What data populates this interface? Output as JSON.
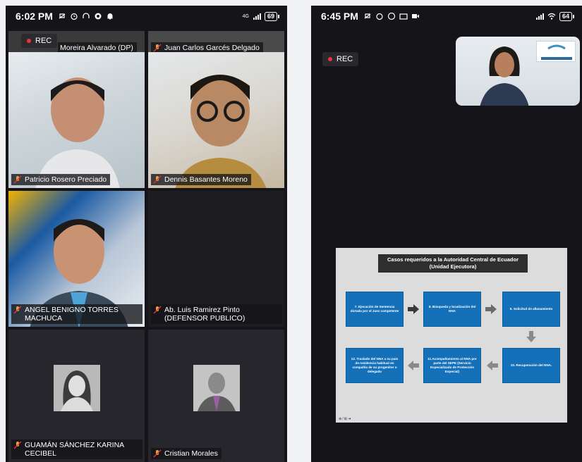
{
  "left_phone": {
    "status": {
      "time": "6:02 PM",
      "network": "4G",
      "battery": "69"
    },
    "rec_label": "REC",
    "participants": [
      {
        "name": "Moreira Alvarado (DP)"
      },
      {
        "name": "Juan Carlos Garcés Delgado"
      },
      {
        "name": "Patricio Rosero Preciado"
      },
      {
        "name": "Dennis Basantes Moreno"
      },
      {
        "name": "ANGEL BENIGNO TORRES MACHUCA"
      },
      {
        "name": "Ab. Luis Ramirez Pinto (DEFENSOR PUBLICO)"
      },
      {
        "name": "GUAMÁN SÁNCHEZ KARINA CECIBEL"
      },
      {
        "name": "Cristian Morales"
      }
    ]
  },
  "right_phone": {
    "status": {
      "time": "6:45 PM",
      "battery": "64"
    },
    "rec_label": "REC",
    "slide": {
      "title_line1": "Casos requeridos a la Autoridad Central de Ecuador",
      "title_line2": "(Unidad Ejecutora)",
      "steps": [
        "7. Ejecución de Sentencia dictada por el Juez competente",
        "8. Búsqueda y localización del NNA",
        "9. Solicitud de allanamiento",
        "10. Recuperación del NNA.",
        "11.Acompañamiento al NNA por parte del SEPE (Servicio Especializado de Protección Especial)",
        "12. Traslado del NNA a su país de residencia habitual en compañía de su progenitor o delegado"
      ],
      "footer": "⊕ ⁄ ⊞ ➜"
    }
  },
  "colors": {
    "rec_dot": "#e8353b",
    "step_blue": "#1470b8",
    "phone_bg": "#141419"
  }
}
